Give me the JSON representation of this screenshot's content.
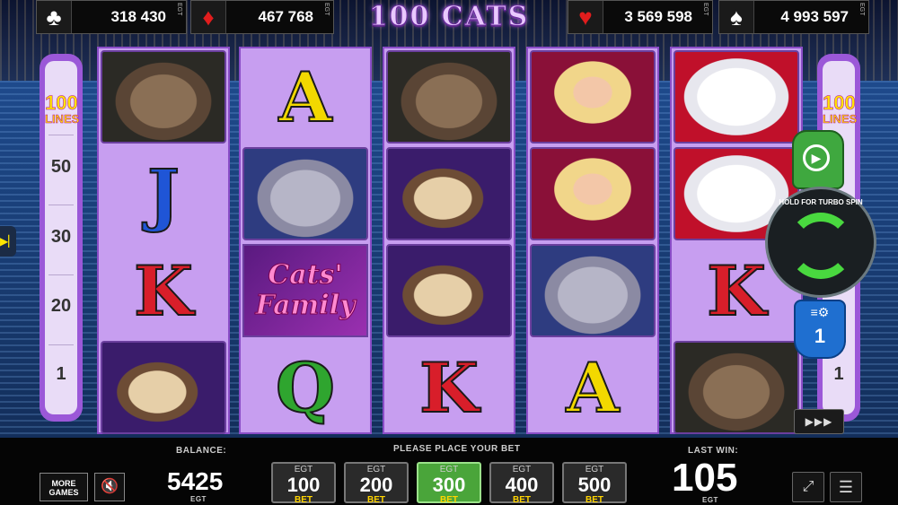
{
  "title": "100 CATS",
  "jackpots": [
    {
      "suit": "♣",
      "color": "#ffffff",
      "value": "318 430",
      "brand": "EGT"
    },
    {
      "suit": "♦",
      "color": "#e11d1d",
      "value": "467 768",
      "brand": "EGT"
    },
    {
      "suit": "♥",
      "color": "#e11d1d",
      "value": "3 569 598",
      "brand": "EGT"
    },
    {
      "suit": "♠",
      "color": "#ffffff",
      "value": "4 993 597",
      "brand": "EGT"
    }
  ],
  "lines_panel": {
    "count": "100",
    "label": "LINES",
    "numbers": [
      "50",
      "30",
      "20",
      "1"
    ]
  },
  "right_panel": {
    "count": "100",
    "label": "LINES",
    "number": "1"
  },
  "reels": [
    [
      "Tabby cat",
      "J",
      "K",
      "Siamese cat"
    ],
    [
      "A",
      "Grey cat",
      "Cats' Family",
      "Q"
    ],
    [
      "Tabby cat",
      "Siamese cat",
      "Siamese cat",
      "K"
    ],
    [
      "Blonde woman",
      "Blonde woman",
      "Grey cat",
      "A"
    ],
    [
      "White cat",
      "White cat",
      "K",
      "Tabby cat"
    ]
  ],
  "scatter_text": [
    "Cats'",
    "Family"
  ],
  "spin": {
    "hint": "HOLD FOR TURBO SPIN"
  },
  "settings": {
    "value": "1"
  },
  "balance": {
    "label": "BALANCE:",
    "value": "5425",
    "currency": "EGT"
  },
  "bet": {
    "prompt": "PLEASE PLACE YOUR BET",
    "options": [
      {
        "brand": "EGT",
        "value": "100",
        "label": "BET",
        "active": false
      },
      {
        "brand": "EGT",
        "value": "200",
        "label": "BET",
        "active": false
      },
      {
        "brand": "EGT",
        "value": "300",
        "label": "BET",
        "active": true
      },
      {
        "brand": "EGT",
        "value": "400",
        "label": "BET",
        "active": false
      },
      {
        "brand": "EGT",
        "value": "500",
        "label": "BET",
        "active": false
      }
    ]
  },
  "last_win": {
    "label": "LAST WIN:",
    "value": "105",
    "currency": "EGT"
  },
  "more_games": "MORE GAMES",
  "icons": {
    "sound": "sound-muted-icon",
    "fullscreen": "fullscreen-icon",
    "menu": "hamburger-menu-icon",
    "fast": "fast-forward-icon"
  }
}
